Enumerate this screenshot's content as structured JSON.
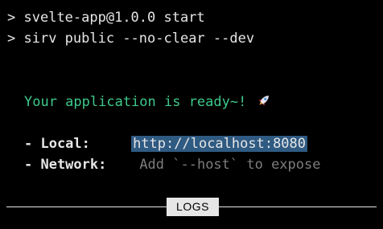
{
  "terminal": {
    "command_line_1": {
      "prompt": ">",
      "text": "svelte-app@1.0.0 start"
    },
    "command_line_2": {
      "prompt": ">",
      "text": "sirv public --no-clear --dev"
    },
    "ready_message": "Your application is ready~!",
    "ready_icon": "rocket-icon",
    "local": {
      "label": "- Local:",
      "url": "http://localhost:8080"
    },
    "network": {
      "label": "- Network:",
      "hint": "Add `--host` to expose"
    },
    "logs_tab_label": "LOGS"
  },
  "colors": {
    "background": "#000000",
    "foreground": "#e6e6e6",
    "ready_green": "#3ec98b",
    "selection_blue": "#2f5a82",
    "dim_gray": "#7d7d7d"
  }
}
